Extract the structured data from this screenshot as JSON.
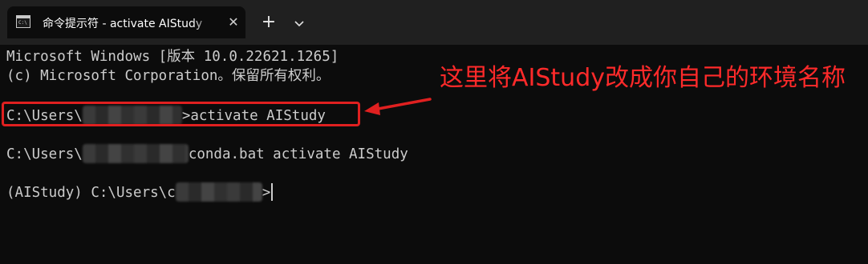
{
  "tab": {
    "title": "命令提示符 - activate  AIStudy",
    "close_glyph": "✕",
    "new_tab_glyph": "+",
    "icon": "terminal-icon"
  },
  "terminal": {
    "line1": "Microsoft Windows [版本 10.0.22621.1265]",
    "line2": "(c) Microsoft Corporation。保留所有权利。",
    "cmd1_prefix": "C:\\Users\\",
    "cmd1_suffix": ">activate AIStudy",
    "cmd2_prefix": "C:\\Users\\",
    "cmd2_suffix": "conda.bat activate AIStudy",
    "cmd3_prefix": "(AIStudy) C:\\Users\\c",
    "cmd3_suffix": ">"
  },
  "annotation": {
    "text": "这里将AIStudy改成你自己的环境名称",
    "color": "#ff2a2a"
  },
  "colors": {
    "terminal_bg": "#0c0c0c",
    "titlebar_bg": "#202020",
    "text": "#cccccc",
    "accent_red": "#e02020"
  }
}
